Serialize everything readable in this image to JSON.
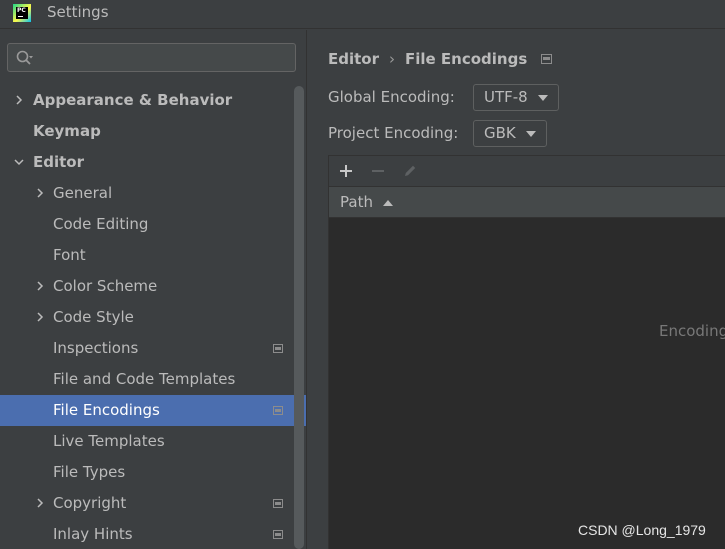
{
  "window": {
    "title": "Settings",
    "logo_text": "PC"
  },
  "search": {
    "placeholder": "",
    "value": ""
  },
  "sidebar": {
    "items": [
      {
        "label": "Appearance & Behavior",
        "bold": true,
        "chevron": "right",
        "badge": false,
        "selected": false
      },
      {
        "label": "Keymap",
        "bold": true,
        "chevron": "none",
        "badge": false,
        "selected": false
      },
      {
        "label": "Editor",
        "bold": true,
        "chevron": "down",
        "badge": false,
        "selected": false
      },
      {
        "label": "General",
        "bold": false,
        "chevron": "right",
        "badge": false,
        "selected": false
      },
      {
        "label": "Code Editing",
        "bold": false,
        "chevron": "none",
        "badge": false,
        "selected": false
      },
      {
        "label": "Font",
        "bold": false,
        "chevron": "none",
        "badge": false,
        "selected": false
      },
      {
        "label": "Color Scheme",
        "bold": false,
        "chevron": "right",
        "badge": false,
        "selected": false
      },
      {
        "label": "Code Style",
        "bold": false,
        "chevron": "right",
        "badge": false,
        "selected": false
      },
      {
        "label": "Inspections",
        "bold": false,
        "chevron": "none",
        "badge": true,
        "selected": false
      },
      {
        "label": "File and Code Templates",
        "bold": false,
        "chevron": "none",
        "badge": false,
        "selected": false
      },
      {
        "label": "File Encodings",
        "bold": false,
        "chevron": "none",
        "badge": true,
        "selected": true
      },
      {
        "label": "Live Templates",
        "bold": false,
        "chevron": "none",
        "badge": false,
        "selected": false
      },
      {
        "label": "File Types",
        "bold": false,
        "chevron": "none",
        "badge": false,
        "selected": false
      },
      {
        "label": "Copyright",
        "bold": false,
        "chevron": "right",
        "badge": true,
        "selected": false
      },
      {
        "label": "Inlay Hints",
        "bold": false,
        "chevron": "none",
        "badge": true,
        "selected": false
      }
    ]
  },
  "breadcrumb": {
    "parent": "Editor",
    "separator": "›",
    "current": "File Encodings"
  },
  "global_encoding": {
    "label": "Global Encoding:",
    "value": "UTF-8"
  },
  "project_encoding": {
    "label": "Project Encoding:",
    "value": "GBK"
  },
  "table": {
    "toolbar": [
      "plus-icon",
      "minus-icon",
      "edit-icon"
    ],
    "column_path": "Path",
    "empty_text": "Encoding"
  },
  "watermark": "CSDN @Long_1979",
  "colors": {
    "background": "#3c3f41",
    "selection": "#4b6eaf",
    "table_body": "#2b2b2b"
  }
}
